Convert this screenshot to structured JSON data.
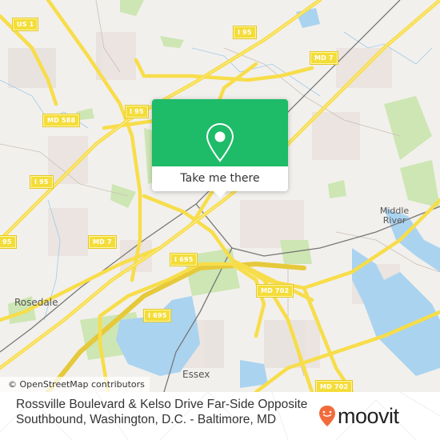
{
  "map": {
    "attribution": "© OpenStreetMap contributors",
    "road_shields": [
      {
        "id": "us1",
        "label": "US 1"
      },
      {
        "id": "i95-top",
        "label": "I 95"
      },
      {
        "id": "i95-center",
        "label": "I 95"
      },
      {
        "id": "i95-left",
        "label": "I 95"
      },
      {
        "id": "i95-edge",
        "label": "95"
      },
      {
        "id": "md588",
        "label": "MD 588"
      },
      {
        "id": "md7-top",
        "label": "MD 7"
      },
      {
        "id": "md7-left",
        "label": "MD 7"
      },
      {
        "id": "i695-a",
        "label": "I 695"
      },
      {
        "id": "i695-b",
        "label": "I 695"
      },
      {
        "id": "md702-a",
        "label": "MD 702"
      },
      {
        "id": "md702-b",
        "label": "MD 702"
      }
    ],
    "places": [
      {
        "id": "rosedale",
        "label": "Rosedale"
      },
      {
        "id": "middle-river",
        "label": "Middle River"
      },
      {
        "id": "essex",
        "label": "Essex"
      }
    ],
    "colors": {
      "land": "#f2f0ec",
      "water": "#aad3f0",
      "park": "#cde6b4",
      "road": "#f7dd4a",
      "popup": "#1ebb68",
      "brand": "#f26b3a"
    }
  },
  "popup": {
    "icon": "location-pin-icon",
    "button_label": "Take me there"
  },
  "footer": {
    "title": "Rossville Boulevard & Kelso Drive Far-Side Opposite Southbound, Washington, D.C. - Baltimore, MD",
    "logo_text": "moovit"
  }
}
